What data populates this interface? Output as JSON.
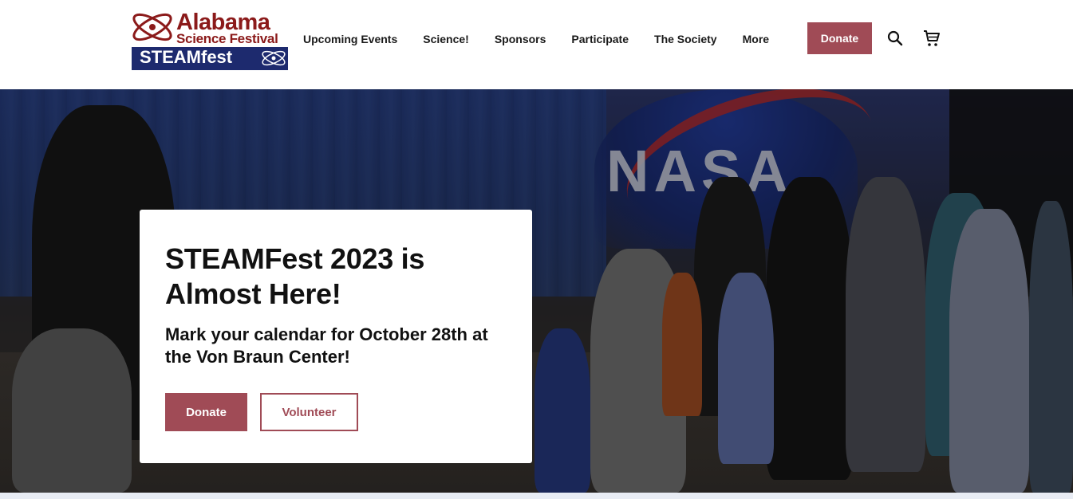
{
  "logo": {
    "line1": "Alabama",
    "line2": "Science Festival",
    "line3": "STEAMfest",
    "colors": {
      "red": "#8b1a1a",
      "navy": "#1d2a6e"
    }
  },
  "nav": {
    "items": [
      {
        "label": "Upcoming Events"
      },
      {
        "label": "Science!"
      },
      {
        "label": "Sponsors"
      },
      {
        "label": "Participate"
      },
      {
        "label": "The Society"
      },
      {
        "label": "More"
      }
    ],
    "donate_label": "Donate",
    "icons": [
      "search-icon",
      "cart-icon"
    ]
  },
  "hero": {
    "background_sign": "NASA",
    "card": {
      "title": "STEAMFest 2023 is Almost Here!",
      "subtitle": "Mark your calendar for October 28th at the Von Braun Center!",
      "donate_label": "Donate",
      "volunteer_label": "Volunteer"
    }
  },
  "colors": {
    "accent": "#a04b56",
    "text": "#111111",
    "background": "#ffffff"
  }
}
